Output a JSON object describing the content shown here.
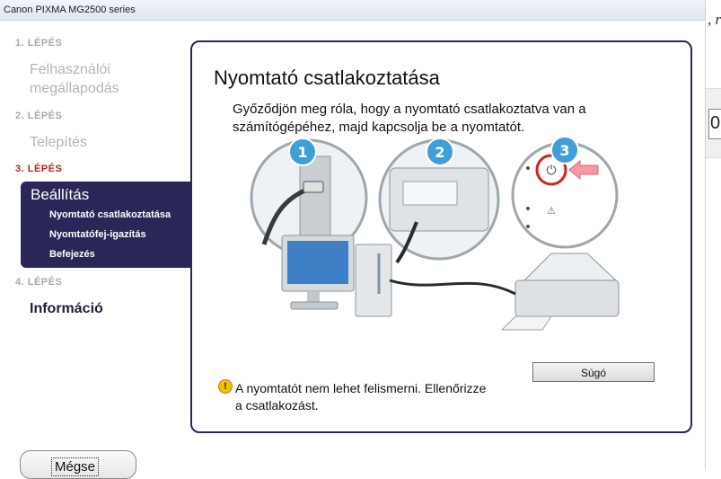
{
  "window": {
    "title": "Canon PIXMA MG2500 series"
  },
  "sidebar": {
    "steps": [
      {
        "label": "1. LÉPÉS",
        "name": "Felhasználói megállapodás"
      },
      {
        "label": "2. LÉPÉS",
        "name": "Telepítés"
      },
      {
        "label": "3. LÉPÉS",
        "name": "Beállítás",
        "subitems": [
          "Nyomtató csatlakoztatása",
          "Nyomtatófej-igazítás",
          "Befejezés"
        ]
      },
      {
        "label": "4. LÉPÉS",
        "name": "Információ"
      }
    ],
    "name_line1": "Felhasználói",
    "name_line2": "megállapodás"
  },
  "main": {
    "title": "Nyomtató csatlakoztatása",
    "desc_line1": "Győződjön meg róla, hogy a nyomtató csatlakoztatva van a",
    "desc_line2": "számítógépéhez, majd kapcsolja be a nyomtatót.",
    "callouts": [
      "1",
      "2",
      "3"
    ],
    "help_button": "Súgó",
    "warning_line1": "A nyomtatót nem lehet felismerni. Ellenőrizze",
    "warning_line2": "a csatlakozást."
  },
  "footer": {
    "cancel_button": "Mégse"
  },
  "right_edge": {
    "text_top": ", r",
    "digit": "0"
  },
  "colors": {
    "accent_navy": "#2b2658",
    "step_active_red": "#c41e1e",
    "callout_blue": "#3f9fd8",
    "power_ring_red": "#d81e1e"
  },
  "icons": [
    "warning-icon",
    "power-icon",
    "usb-plug-icon",
    "arrow-left-icon"
  ]
}
